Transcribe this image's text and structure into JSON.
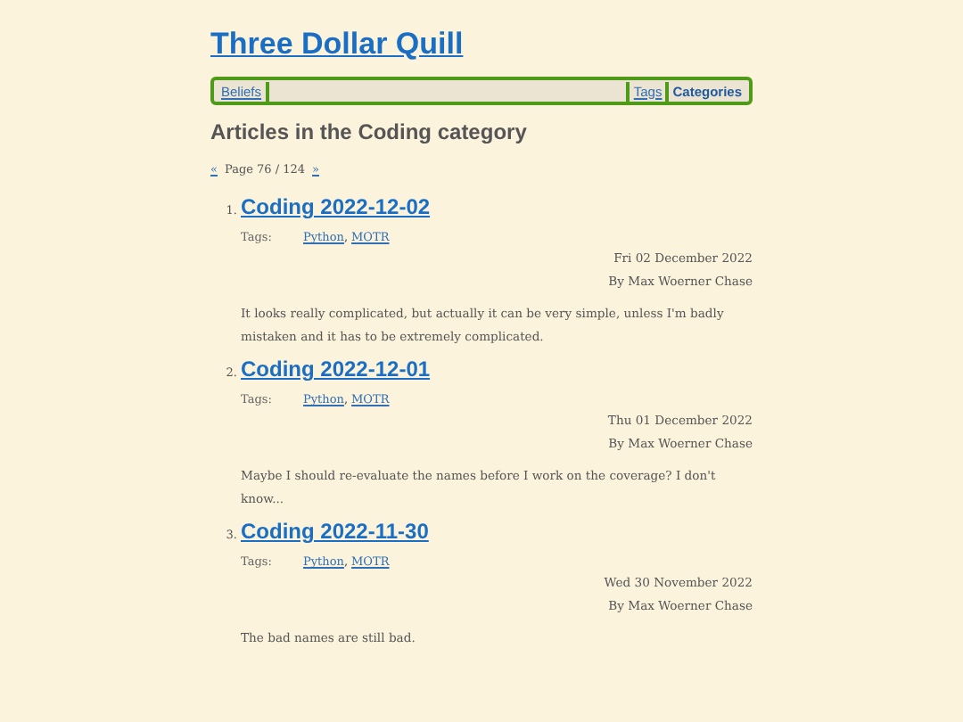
{
  "site_title": "Three Dollar Quill",
  "nav_left": [
    {
      "label": "Beliefs",
      "selected": false
    }
  ],
  "nav_right": [
    {
      "label": "Tags",
      "selected": false
    },
    {
      "label": "Categories",
      "selected": true
    }
  ],
  "heading": "Articles in the Coding category",
  "pagination": {
    "prev": "«",
    "page": "Page 76 / 124",
    "next": "»"
  },
  "articles": [
    {
      "number": "1.",
      "title": "Coding 2022-12-02",
      "tags_label": "Tags:",
      "tags": [
        {
          "kind": "link",
          "text": "Python"
        },
        {
          "kind": "separator",
          "text": ","
        },
        {
          "kind": "link",
          "text": "MOTR"
        }
      ],
      "date": "Fri 02 December 2022",
      "author": "By Max Woerner Chase",
      "summary": "It looks really complicated, but actually it can be very simple, unless I'm badly mistaken and it has to be extremely complicated."
    },
    {
      "number": "2.",
      "title": "Coding 2022-12-01",
      "tags_label": "Tags:",
      "tags": [
        {
          "kind": "link",
          "text": "Python"
        },
        {
          "kind": "separator",
          "text": ","
        },
        {
          "kind": "link",
          "text": "MOTR"
        }
      ],
      "date": "Thu 01 December 2022",
      "author": "By Max Woerner Chase",
      "summary": "Maybe I should re-evaluate the names before I work on the coverage? I don't know..."
    },
    {
      "number": "3.",
      "title": "Coding 2022-11-30",
      "tags_label": "Tags:",
      "tags": [
        {
          "kind": "link",
          "text": "Python"
        },
        {
          "kind": "separator",
          "text": ","
        },
        {
          "kind": "link",
          "text": "MOTR"
        }
      ],
      "date": "Wed 30 November 2022",
      "author": "By Max Woerner Chase",
      "summary": "The bad names are still bad."
    }
  ]
}
